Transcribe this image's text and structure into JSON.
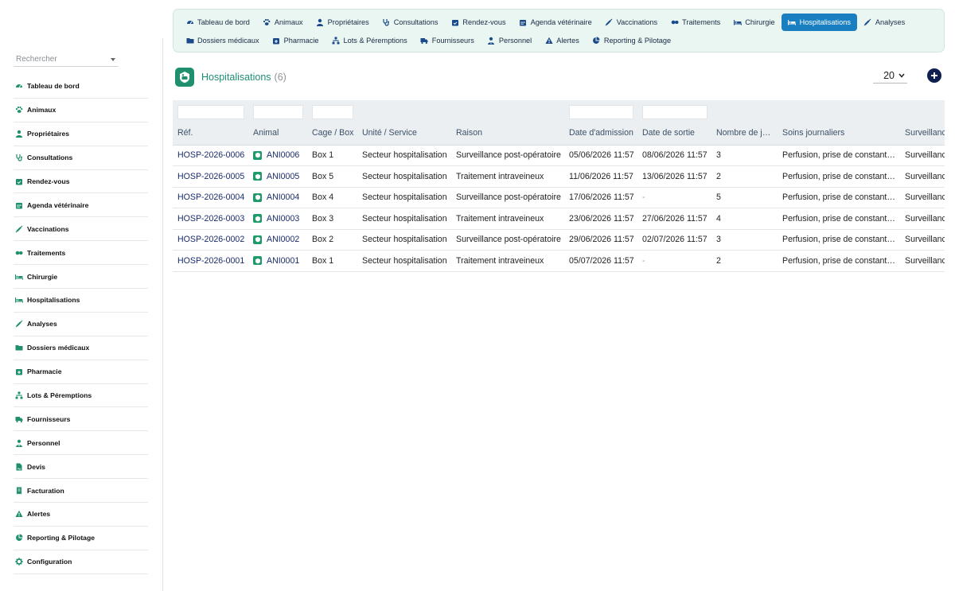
{
  "search": {
    "placeholder": "Rechercher"
  },
  "sidebar": {
    "items": [
      {
        "label": "Tableau de bord",
        "icon": "dashboard-icon"
      },
      {
        "label": "Animaux",
        "icon": "paw-icon"
      },
      {
        "label": "Propriétaires",
        "icon": "user-icon"
      },
      {
        "label": "Consultations",
        "icon": "stethoscope-icon"
      },
      {
        "label": "Rendez-vous",
        "icon": "calendar-check-icon"
      },
      {
        "label": "Agenda vétérinaire",
        "icon": "calendar-icon"
      },
      {
        "label": "Vaccinations",
        "icon": "syringe-icon"
      },
      {
        "label": "Traitements",
        "icon": "pills-icon"
      },
      {
        "label": "Chirurgie",
        "icon": "bed-icon"
      },
      {
        "label": "Hospitalisations",
        "icon": "bed-icon"
      },
      {
        "label": "Analyses",
        "icon": "syringe-icon"
      },
      {
        "label": "Dossiers médicaux",
        "icon": "folder-icon"
      },
      {
        "label": "Pharmacie",
        "icon": "pharmacy-icon"
      },
      {
        "label": "Lots & Péremptions",
        "icon": "sitemap-icon"
      },
      {
        "label": "Fournisseurs",
        "icon": "truck-icon"
      },
      {
        "label": "Personnel",
        "icon": "user-tie-icon"
      },
      {
        "label": "Devis",
        "icon": "file-signature-icon"
      },
      {
        "label": "Facturation",
        "icon": "receipt-icon"
      },
      {
        "label": "Alertes",
        "icon": "warning-icon"
      },
      {
        "label": "Reporting & Pilotage",
        "icon": "chart-pie-icon"
      },
      {
        "label": "Configuration",
        "icon": "gear-icon"
      }
    ]
  },
  "topmenu": {
    "row1": [
      {
        "label": "Tableau de bord",
        "icon": "dashboard-icon"
      },
      {
        "label": "Animaux",
        "icon": "paw-icon"
      },
      {
        "label": "Propriétaires",
        "icon": "user-icon"
      },
      {
        "label": "Consultations",
        "icon": "stethoscope-icon"
      },
      {
        "label": "Rendez-vous",
        "icon": "calendar-check-icon"
      },
      {
        "label": "Agenda vétérinaire",
        "icon": "calendar-icon"
      },
      {
        "label": "Vaccinations",
        "icon": "syringe-icon"
      },
      {
        "label": "Traitements",
        "icon": "pills-icon"
      },
      {
        "label": "Chirurgie",
        "icon": "bed-icon"
      },
      {
        "label": "Hospitalisations",
        "icon": "bed-icon",
        "active": true
      },
      {
        "label": "Analyses",
        "icon": "syringe-icon"
      }
    ],
    "row2": [
      {
        "label": "Dossiers médicaux",
        "icon": "folder-icon"
      },
      {
        "label": "Pharmacie",
        "icon": "pharmacy-icon"
      },
      {
        "label": "Lots & Péremptions",
        "icon": "sitemap-icon"
      },
      {
        "label": "Fournisseurs",
        "icon": "truck-icon"
      },
      {
        "label": "Personnel",
        "icon": "user-tie-icon"
      },
      {
        "label": "Alertes",
        "icon": "warning-icon"
      },
      {
        "label": "Reporting & Pilotage",
        "icon": "chart-pie-icon"
      }
    ]
  },
  "header": {
    "title": "Hospitalisations",
    "count": "(6)",
    "limit": "20"
  },
  "colors": {
    "accent": "#1a7fc1",
    "brand": "#1f8f6e",
    "link": "#1a2b6d"
  },
  "table": {
    "columns": [
      "Réf.",
      "Animal",
      "Cage / Box",
      "Unité / Service",
      "Raison",
      "Date d'admission",
      "Date de sortie",
      "Nombre de j…",
      "Soins journaliers",
      "Surveillance"
    ],
    "rows": [
      [
        "HOSP-2026-0006",
        "ANI0006",
        "Box 1",
        "Secteur hospitalisation",
        "Surveillance post-opératoire",
        "05/06/2026 11:57",
        "08/06/2026 11:57",
        "3",
        "Perfusion, prise de constant…",
        "Surveillance"
      ],
      [
        "HOSP-2026-0005",
        "ANI0005",
        "Box 5",
        "Secteur hospitalisation",
        "Traitement intraveineux",
        "11/06/2026 11:57",
        "13/06/2026 11:57",
        "2",
        "Perfusion, prise de constant…",
        "Surveillance"
      ],
      [
        "HOSP-2026-0004",
        "ANI0004",
        "Box 4",
        "Secteur hospitalisation",
        "Surveillance post-opératoire",
        "17/06/2026 11:57",
        "-",
        "5",
        "Perfusion, prise de constant…",
        "Surveillance"
      ],
      [
        "HOSP-2026-0003",
        "ANI0003",
        "Box 3",
        "Secteur hospitalisation",
        "Traitement intraveineux",
        "23/06/2026 11:57",
        "27/06/2026 11:57",
        "4",
        "Perfusion, prise de constant…",
        "Surveillance"
      ],
      [
        "HOSP-2026-0002",
        "ANI0002",
        "Box 2",
        "Secteur hospitalisation",
        "Surveillance post-opératoire",
        "29/06/2026 11:57",
        "02/07/2026 11:57",
        "3",
        "Perfusion, prise de constant…",
        "Surveillance"
      ],
      [
        "HOSP-2026-0001",
        "ANI0001",
        "Box 1",
        "Secteur hospitalisation",
        "Traitement intraveineux",
        "05/07/2026 11:57",
        "-",
        "2",
        "Perfusion, prise de constant…",
        "Surveillance"
      ]
    ]
  }
}
